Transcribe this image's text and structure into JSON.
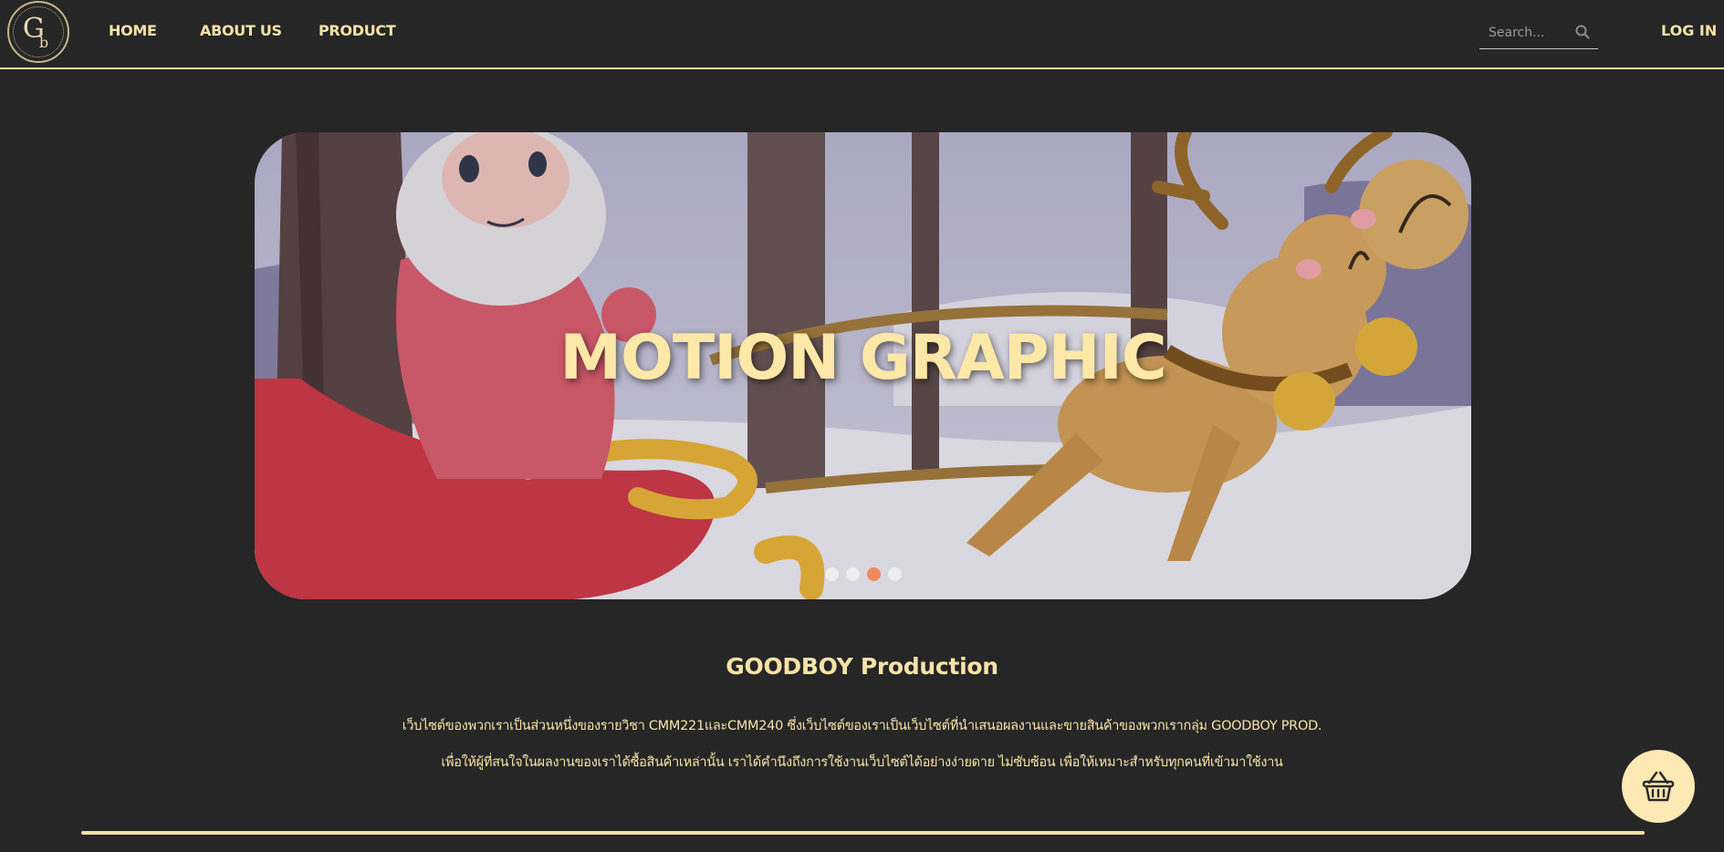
{
  "nav": {
    "logo": "Gb",
    "links": [
      "HOME",
      "ABOUT US",
      "PRODUCT"
    ],
    "search_placeholder": "Search...",
    "login": "LOG IN"
  },
  "banner": {
    "title": "MOTION GRAPHIC",
    "slide_count": 4,
    "active_slide": 3
  },
  "intro": {
    "title": "GOODBOY Production",
    "line1": "เว็บไซต์ของพวกเราเป็นส่วนหนึ่งของรายวิชา CMM221และCMM240 ซึ่งเว็บไซต์ของเราเป็นเว็บไซต์ที่นำเสนอผลงานและขายสินค้าของพวกเรากลุ่ม GOODBOY PROD.",
    "line2": "เพื่อให้ผู้ที่สนใจในผลงานของเราได้ซื้อสินค้าเหล่านั้น เราได้คำนึงถึงการใช้งานเว็บไซต์ได้อย่างง่ายดาย ไม่ซับซ้อน เพื่อให้เหมาะสำหรับทุกคนที่เข้ามาใช้งาน"
  },
  "colors": {
    "background": "#262626",
    "accent": "#f7e3a6",
    "active_dot": "#f08a5d",
    "cart_bg": "#fde9b4"
  },
  "icons": {
    "search": "search-icon",
    "cart": "basket-icon"
  }
}
